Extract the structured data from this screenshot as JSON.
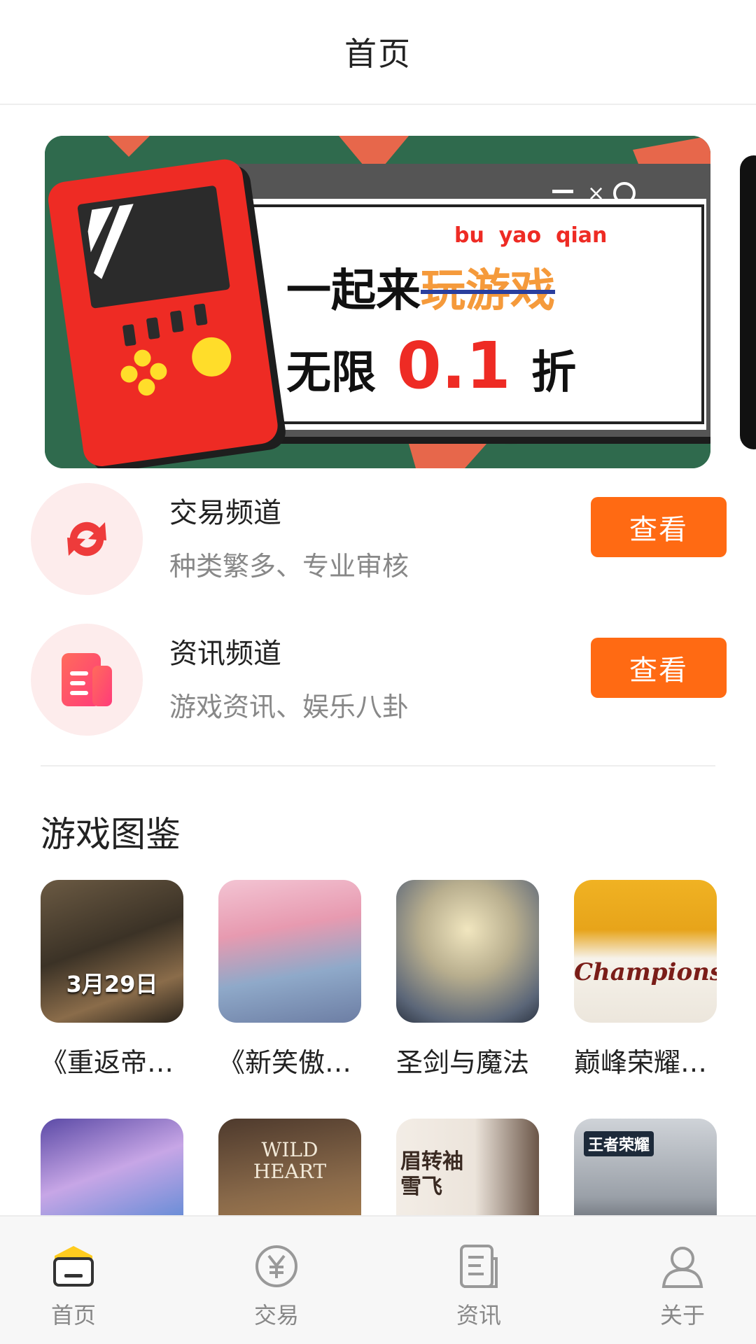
{
  "header": {
    "title": "首页"
  },
  "banner": {
    "line1": "一起来",
    "line1_highlight": "玩游戏",
    "pinyin": "bu  yao  qian",
    "line2_prefix": "无限",
    "line2_value": "0.1",
    "line2_suffix": "折"
  },
  "channels": [
    {
      "name": "交易频道",
      "desc": "种类繁多、专业审核",
      "button": "查看"
    },
    {
      "name": "资讯频道",
      "desc": "游戏资讯、娱乐八卦",
      "button": "查看"
    }
  ],
  "section": {
    "title": "游戏图鉴"
  },
  "games": [
    {
      "label": "《重返帝国》",
      "thumb_text": "3月29日"
    },
    {
      "label": "《新笑傲江湖》",
      "thumb_text": ""
    },
    {
      "label": "圣剑与魔法",
      "thumb_text": ""
    },
    {
      "label": "巅峰荣耀传奇",
      "thumb_text": "Champions"
    },
    {
      "label": "",
      "thumb_text": ""
    },
    {
      "label": "",
      "thumb_text": "WILD HEART"
    },
    {
      "label": "",
      "thumb_text": "眉转袖雪飞"
    },
    {
      "label": "",
      "thumb_text": "王者荣耀"
    }
  ],
  "tabs": [
    {
      "label": "首页",
      "icon": "home-icon",
      "active": true
    },
    {
      "label": "交易",
      "icon": "yen-icon",
      "active": false
    },
    {
      "label": "资讯",
      "icon": "news-icon",
      "active": false
    },
    {
      "label": "关于",
      "icon": "person-icon",
      "active": false
    }
  ],
  "colors": {
    "accent": "#ff6a13",
    "banner_red": "#ee2b24",
    "banner_green": "#2f6a4d"
  }
}
